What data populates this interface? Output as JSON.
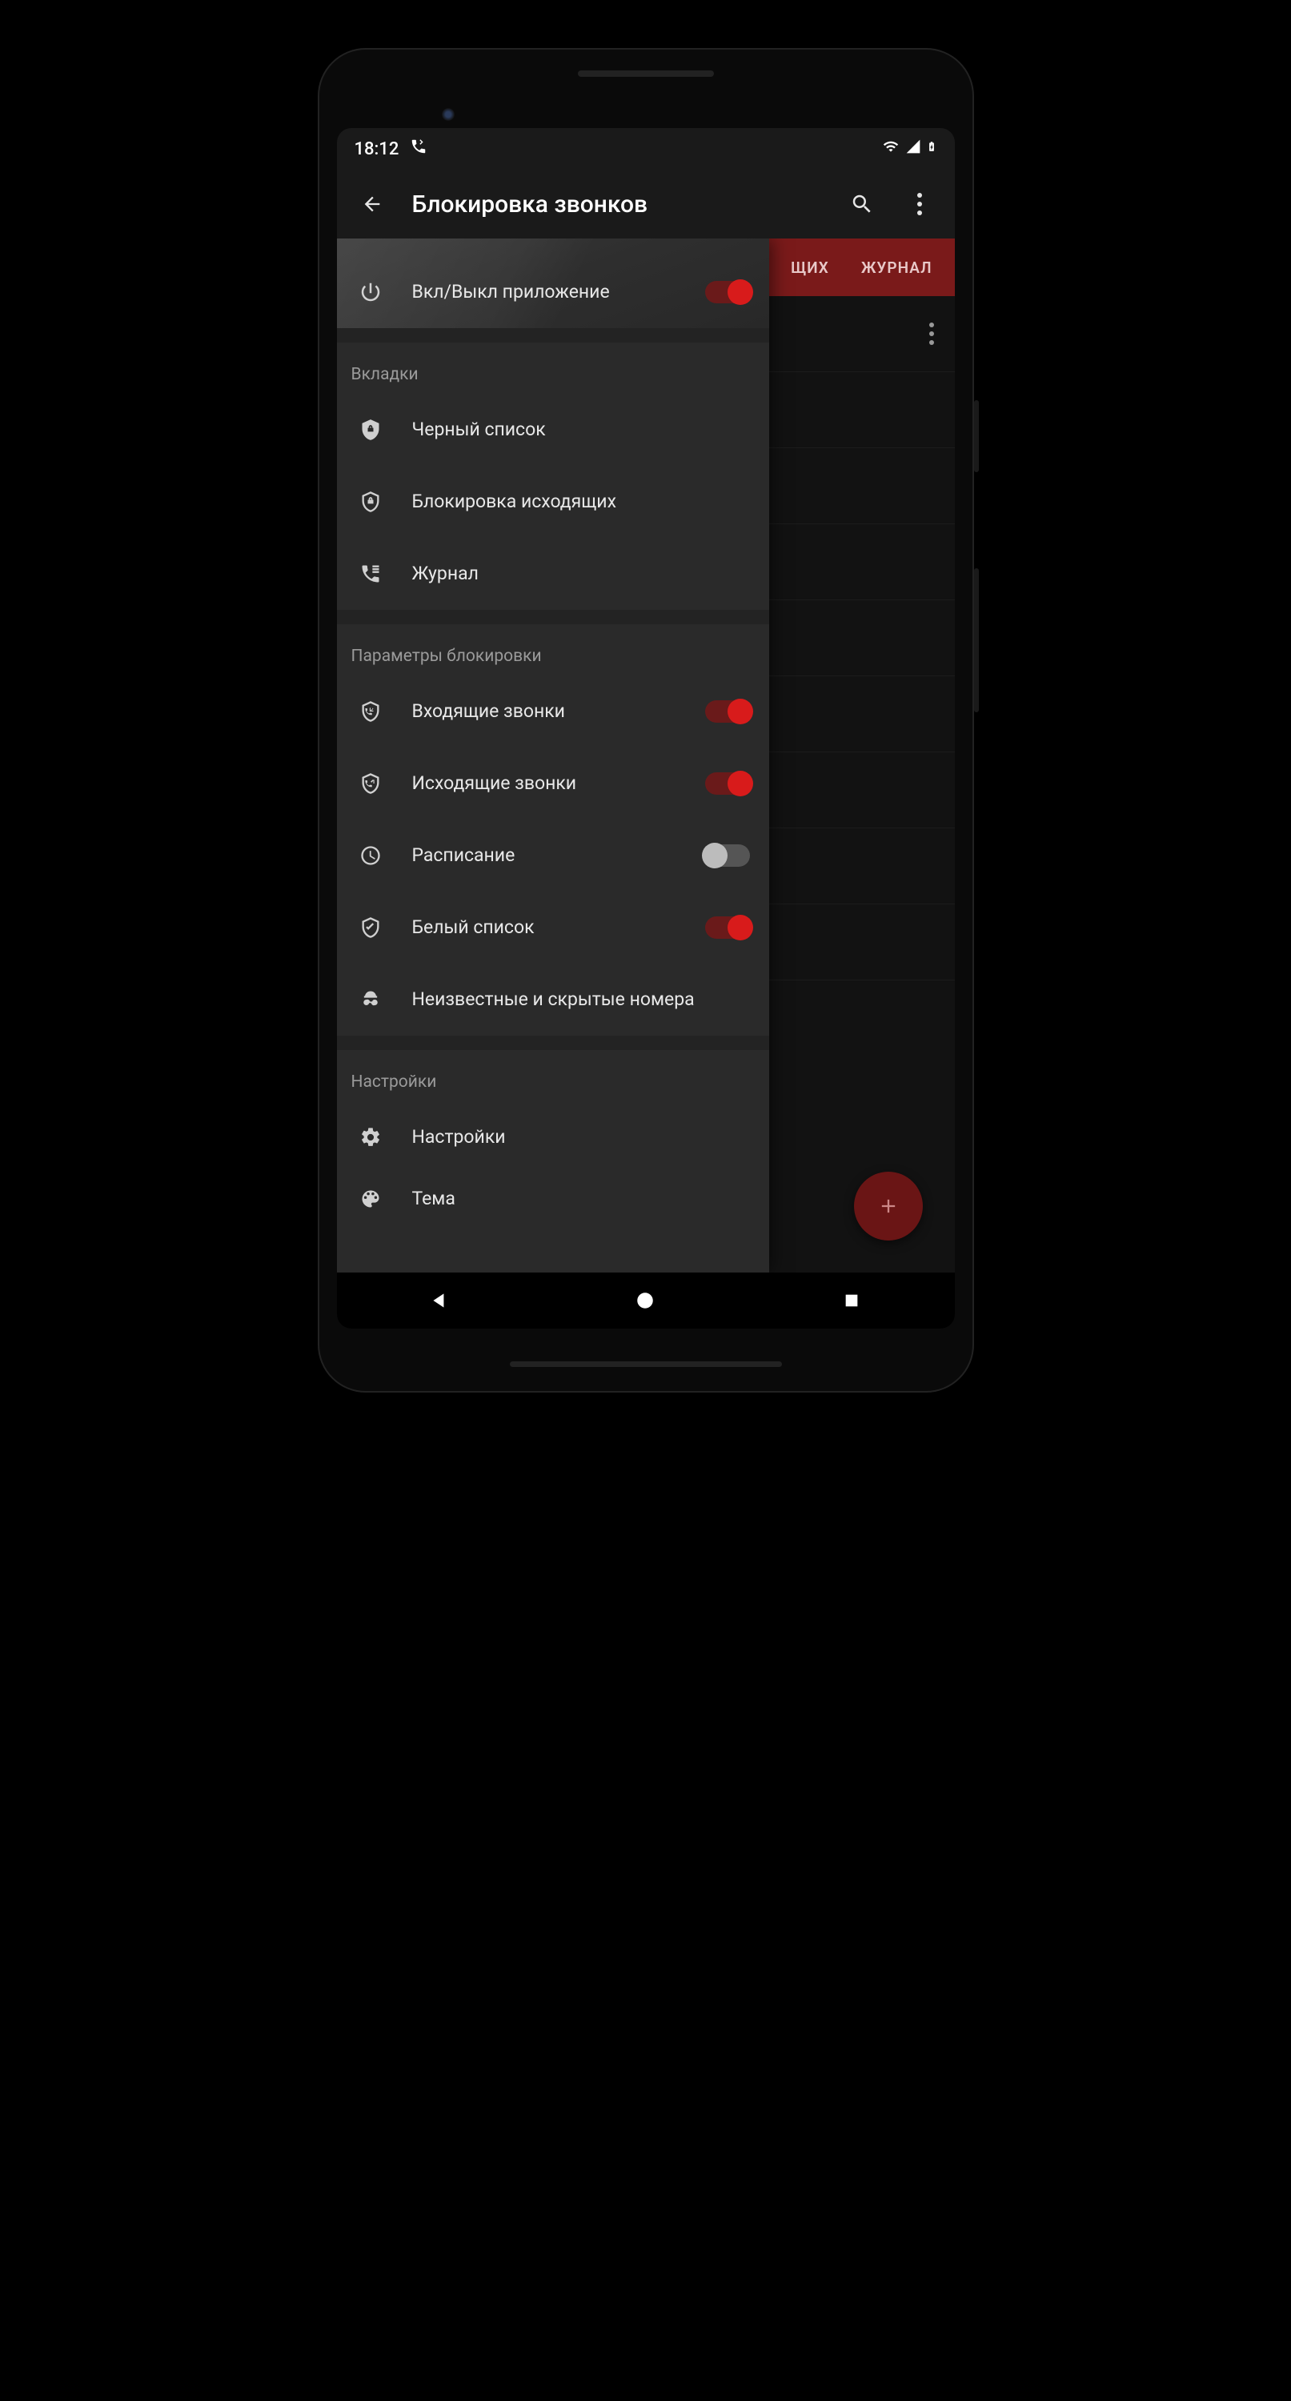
{
  "statusbar": {
    "time": "18:12"
  },
  "appbar": {
    "title": "Блокировка звонков"
  },
  "tabs": {
    "right1": "ЩИХ",
    "right2": "ЖУРНАЛ"
  },
  "drawer": {
    "power": {
      "label": "Вкл/Выкл приложение",
      "on": true
    },
    "section_tabs": "Вкладки",
    "tab_items": [
      {
        "label": "Черный список"
      },
      {
        "label": "Блокировка исходящих"
      },
      {
        "label": "Журнал"
      }
    ],
    "section_params": "Параметры блокировки",
    "param_items": [
      {
        "label": "Входящие звонки",
        "on": true
      },
      {
        "label": "Исходящие звонки",
        "on": true
      },
      {
        "label": "Расписание",
        "on": false
      },
      {
        "label": "Белый список",
        "on": true
      },
      {
        "label": "Неизвестные и скрытые номера"
      }
    ],
    "section_settings": "Настройки",
    "settings_items": [
      {
        "label": "Настройки"
      },
      {
        "label": "Тема"
      }
    ]
  }
}
